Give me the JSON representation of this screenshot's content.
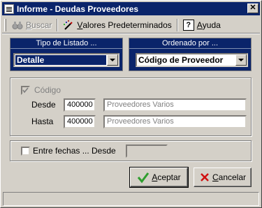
{
  "window": {
    "title": "Informe - Deudas Proveedores",
    "close": "✕"
  },
  "toolbar": {
    "buscar": {
      "first": "B",
      "rest": "uscar"
    },
    "valores": {
      "first": "V",
      "rest": "alores Predeterminados"
    },
    "ayuda": {
      "first": "A",
      "rest": "yuda"
    },
    "help_glyph": "?"
  },
  "tipo_listado": {
    "label": "Tipo de Listado ...",
    "value": "Detalle"
  },
  "ordenado_por": {
    "label": "Ordenado por ...",
    "value": "Código de Proveedor"
  },
  "codigo": {
    "label": "Código",
    "desde_label": "Desde",
    "desde_code": "400000",
    "desde_name": "Proveedores Varios",
    "hasta_label": "Hasta",
    "hasta_code": "400000",
    "hasta_name": "Proveedores Varios"
  },
  "fechas": {
    "label": "Entre fechas ...",
    "desde_label": "Desde",
    "desde_value": ""
  },
  "buttons": {
    "aceptar": {
      "first": "A",
      "rest": "ceptar"
    },
    "cancelar": {
      "first": "C",
      "rest": "ancelar"
    }
  },
  "colors": {
    "title_bar": "#0a246a",
    "accept_icon": "#2e9e2e",
    "cancel_icon": "#d01010"
  }
}
